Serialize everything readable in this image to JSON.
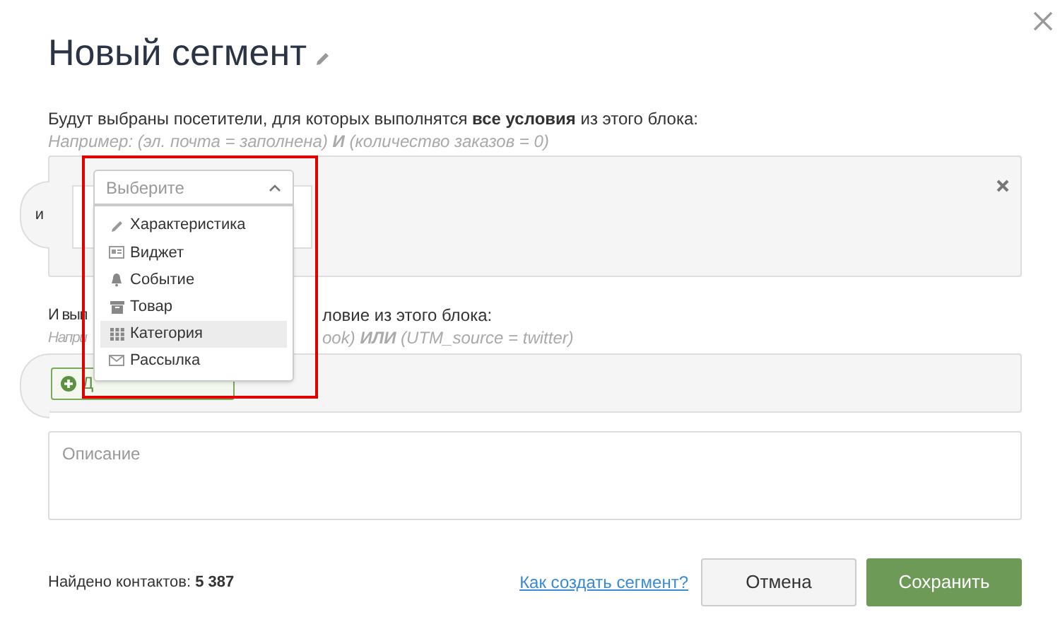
{
  "dialog": {
    "title": "Новый сегмент"
  },
  "block_all": {
    "description": "Будут выбраны посетители, для которых выполнятся **все условия** из этого блока:",
    "hint": "Например: (эл. почта = заполнена) **И** (количество заказов = 0)",
    "connector": "и"
  },
  "dropdown": {
    "placeholder": "Выберите",
    "expanded": true,
    "items": [
      {
        "label": "Характеристика",
        "selected": false
      },
      {
        "label": "Виджет",
        "selected": false
      },
      {
        "label": "Событие",
        "selected": false
      },
      {
        "label": "Товар",
        "selected": false
      },
      {
        "label": "Категория",
        "selected": true
      },
      {
        "label": "Рассылка",
        "selected": false
      }
    ]
  },
  "block_any": {
    "description_parts": [
      "И вып",
      "ловие из этого блока:"
    ],
    "hint_parts": [
      "Напри",
      "ook) **ИЛИ** (UTM_source = twitter)"
    ],
    "add_button": "Д"
  },
  "description_field": {
    "placeholder": "Описание"
  },
  "footer": {
    "found": "Найдено контактов: **5 387**",
    "help_link": "Как создать сегмент?",
    "buttons": [
      {
        "label": "Отмена",
        "kind": "secondary"
      },
      {
        "label": "Сохранить",
        "kind": "primary"
      }
    ]
  }
}
